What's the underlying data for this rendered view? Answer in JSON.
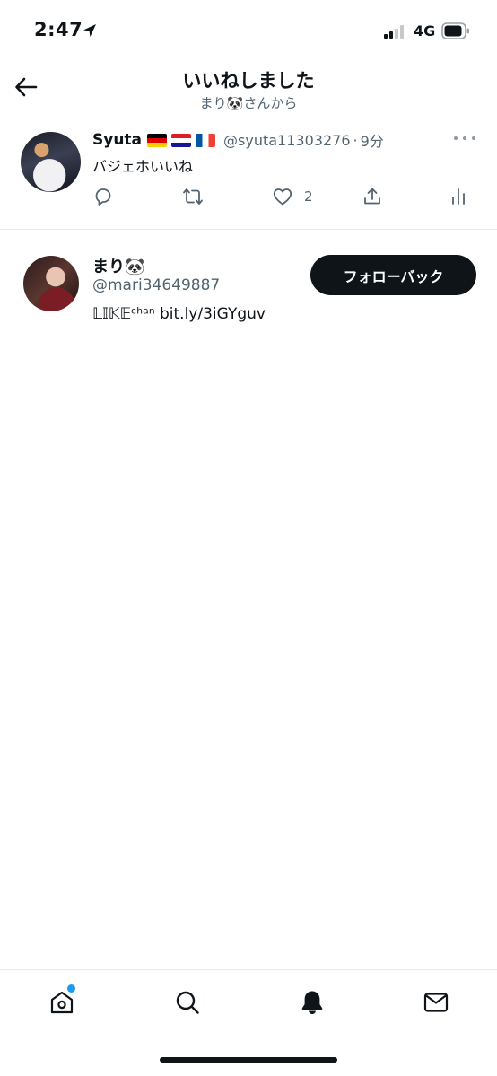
{
  "status_bar": {
    "time": "2:47",
    "network": "4G"
  },
  "header": {
    "title": "いいねしました",
    "subtitle": "まり🐼さんから"
  },
  "tweet": {
    "author_name": "Syuta",
    "flags": [
      "germany",
      "croatia",
      "france"
    ],
    "handle": "@syuta11303276",
    "separator": "·",
    "time": "9分",
    "text": "バジェホいいね",
    "like_count": "2"
  },
  "user": {
    "name": "まり🐼",
    "handle": "@mari34649887",
    "bio": "𝕃𝕀𝕂𝔼ᶜʰᵃⁿ bit.ly/3iGYguv",
    "follow_label": "フォローバック"
  },
  "tab_bar": {
    "items": [
      "home",
      "search",
      "notifications",
      "messages"
    ],
    "active": "notifications"
  },
  "colors": {
    "text": "#0f1419",
    "secondary": "#536471",
    "accent": "#1d9bf0",
    "divider": "#e7ecef"
  }
}
